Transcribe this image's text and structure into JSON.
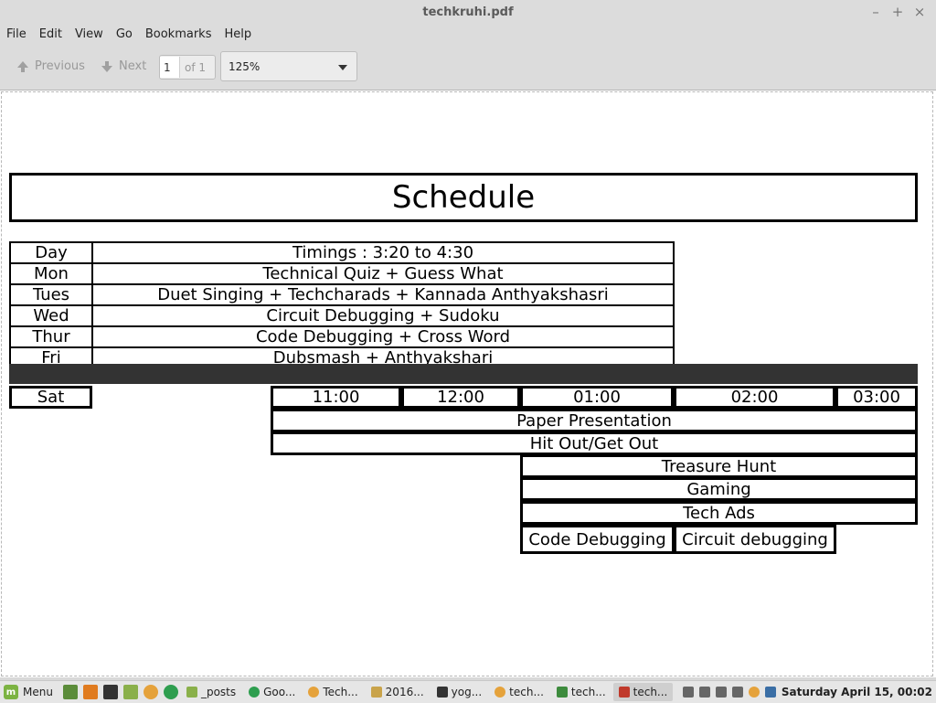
{
  "window": {
    "title": "techkruhi.pdf",
    "minimize": "–",
    "maximize": "+",
    "close": "×"
  },
  "menu": [
    "File",
    "Edit",
    "View",
    "Go",
    "Bookmarks",
    "Help"
  ],
  "toolbar": {
    "previous_label": "Previous",
    "next_label": "Next",
    "page_value": "1",
    "page_total": "of 1",
    "zoom": "125%"
  },
  "document": {
    "title": "Schedule",
    "header": {
      "day": "Day",
      "timings": "Timings : 3:20 to 4:30"
    },
    "weekdays": [
      {
        "day": "Mon",
        "activity": "Technical Quiz + Guess What"
      },
      {
        "day": "Tues",
        "activity": "Duet Singing  + Techcharads + Kannada Anthyakshasri"
      },
      {
        "day": "Wed",
        "activity": "Circuit  Debugging + Sudoku"
      },
      {
        "day": "Thur",
        "activity": "Code  Debugging + Cross Word"
      },
      {
        "day": "Fri",
        "activity": "Dubsmash + Anthyakshari"
      }
    ],
    "saturday": {
      "day": "Sat",
      "times": [
        "11:00",
        "12:00",
        "01:00",
        "02:00",
        "03:00"
      ],
      "events": [
        "Paper Presentation",
        "Hit Out/Get Out",
        "Treasure  Hunt",
        "Gaming",
        "Tech Ads",
        "Code Debugging",
        "Circuit debugging"
      ]
    }
  },
  "taskbar": {
    "menu_label": "Menu",
    "tasks": [
      "_posts",
      "Goo...",
      "Tech...",
      "2016...",
      "yog...",
      "tech...",
      "tech...",
      "tech..."
    ],
    "clock": "Saturday April 15, 00:02"
  },
  "colors": {
    "accent_green": "#7cb342",
    "dark_bar": "#333333"
  }
}
